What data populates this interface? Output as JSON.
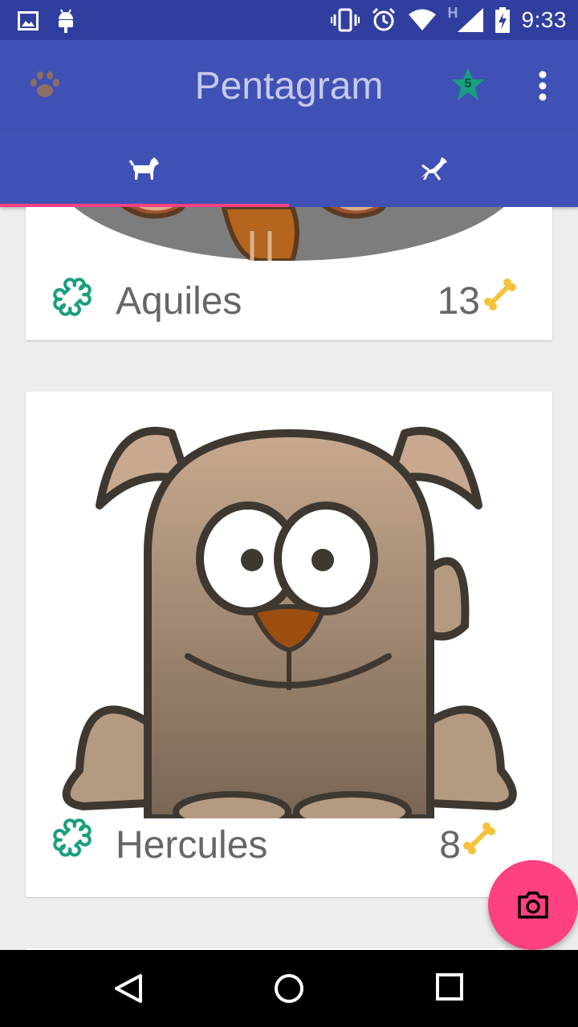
{
  "status_bar": {
    "time": "9:33",
    "network_type": "H",
    "icons": [
      "gallery-icon",
      "android-icon",
      "vibrate-icon",
      "alarm-icon",
      "wifi-icon",
      "signal-icon",
      "battery-charging-icon"
    ]
  },
  "toolbar": {
    "title": "Pentagram",
    "logo_icon": "paw-icon",
    "favorites_count": "5",
    "overflow_icon": "more-vert-icon"
  },
  "tabs": [
    {
      "icon": "dog-standing-icon",
      "selected": true
    },
    {
      "icon": "dog-running-icon",
      "selected": false
    }
  ],
  "pets": [
    {
      "name": "Aquiles",
      "likes": "13"
    },
    {
      "name": "Hercules",
      "likes": "8"
    }
  ],
  "fab": {
    "icon": "camera-icon"
  },
  "nav_bar": {
    "icons": [
      "back-icon",
      "home-icon",
      "recents-icon"
    ]
  },
  "colors": {
    "primary": "#3f51b5",
    "primary_dark": "#303f9f",
    "accent": "#ff4081",
    "bone_teal": "#1a9e80",
    "bone_gold": "#f5c33b"
  }
}
